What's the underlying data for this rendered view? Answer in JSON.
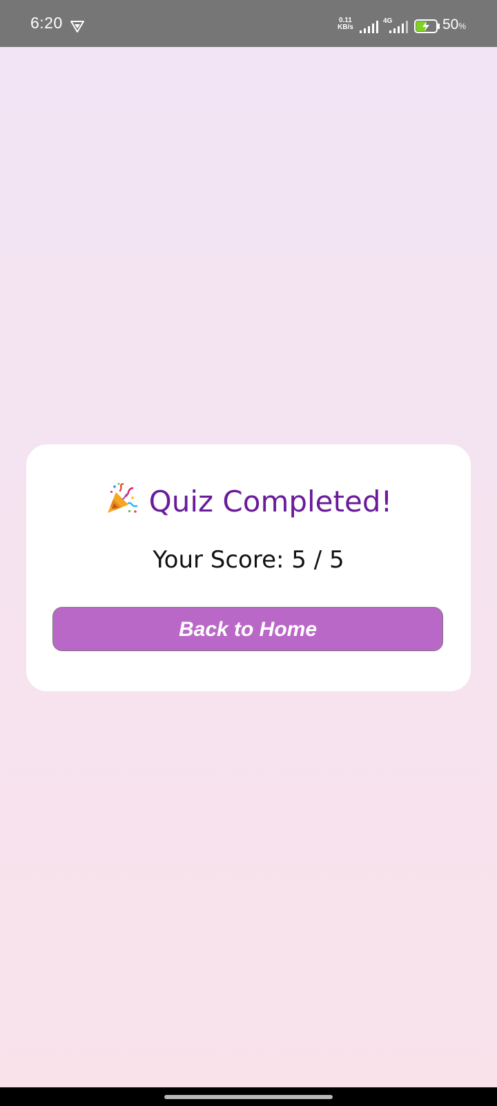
{
  "status_bar": {
    "time": "6:20",
    "net_speed_value": "0.11",
    "net_speed_unit": "KB/s",
    "network_type": "4G",
    "battery_percent": "50",
    "battery_unit": "%",
    "battery_level": 0.5,
    "battery_charging": true,
    "icons": [
      "vpn-shield-icon",
      "signal-strength-icon",
      "signal-strength-icon",
      "battery-charging-icon"
    ]
  },
  "result_card": {
    "title": "Quiz Completed!",
    "title_icon": "party-popper-icon",
    "score_text": "Your Score: 5 / 5",
    "back_button_label": "Back to Home"
  },
  "colors": {
    "accent": "#6a1b9a",
    "button": "#ba68c8",
    "background_top": "#f2e4f5",
    "background_bottom": "#f9e2ea",
    "status_bar": "#767676",
    "battery_fill": "#7ed321"
  }
}
